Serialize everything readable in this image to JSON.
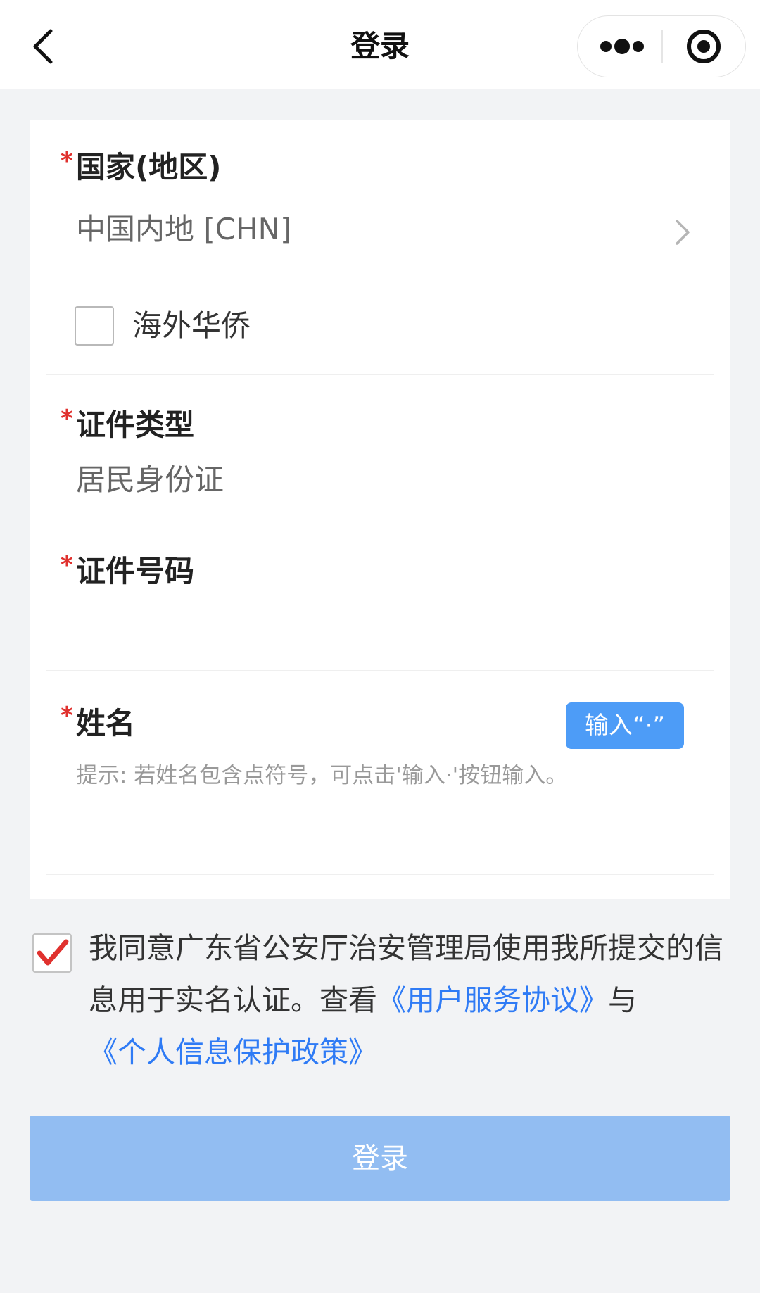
{
  "header": {
    "title": "登录"
  },
  "form": {
    "country": {
      "label": "国家(地区)",
      "required_mark": "*",
      "value": "中国内地 [CHN]"
    },
    "overseas": {
      "label": "海外华侨",
      "checked": false
    },
    "id_type": {
      "label": "证件类型",
      "required_mark": "*",
      "value": "居民身份证"
    },
    "id_number": {
      "label": "证件号码",
      "required_mark": "*",
      "value": ""
    },
    "name": {
      "label": "姓名",
      "required_mark": "*",
      "value": "",
      "dot_button_label": "输入“·”",
      "hint": "提示: 若姓名包含点符号，可点击'输入·'按钮输入。"
    }
  },
  "agreement": {
    "checked": true,
    "text_before": "我同意广东省公安厅治安管理局使用我所提交的信息用于实名认证。查看",
    "service_link": "《用户服务协议》",
    "text_mid": "与",
    "privacy_link": "《个人信息保护政策》"
  },
  "login_button": {
    "label": "登录"
  },
  "colors": {
    "accent": "#4d9cf7",
    "link": "#2f7bf5",
    "required": "#e0312e",
    "check": "#e0312e",
    "login_disabled": "#92bdf2",
    "background": "#f2f3f5"
  },
  "icons": {
    "back": "chevron-left-icon",
    "more": "more-dots-icon",
    "close": "target-close-icon",
    "chevron": "chevron-right-icon",
    "check": "checkmark-icon"
  }
}
